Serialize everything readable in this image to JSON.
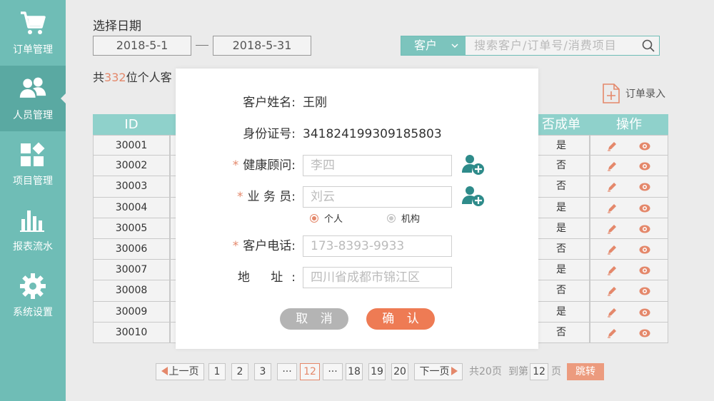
{
  "sidebar": {
    "items": [
      {
        "label": "订单管理",
        "icon": "cart-icon"
      },
      {
        "label": "人员管理",
        "icon": "people-icon"
      },
      {
        "label": "项目管理",
        "icon": "grid-icon"
      },
      {
        "label": "报表流水",
        "icon": "bar-chart-icon"
      },
      {
        "label": "系统设置",
        "icon": "gear-icon"
      }
    ],
    "active_index": 1
  },
  "filter": {
    "title": "选择日期",
    "date_from": "2018-5-1",
    "date_to": "2018-5-31"
  },
  "search": {
    "select_value": "客户",
    "placeholder": "搜索客户/订单号/消费项目"
  },
  "summary": {
    "prefix": "共",
    "count": "332",
    "suffix": "位个人客"
  },
  "order_entry_label": "订单录入",
  "table": {
    "headers": {
      "id": "ID",
      "closed": "否成单",
      "actions": "操作"
    },
    "rows": [
      {
        "id": "30001",
        "closed": "是"
      },
      {
        "id": "30002",
        "closed": "否"
      },
      {
        "id": "30003",
        "closed": "否"
      },
      {
        "id": "30004",
        "closed": "是"
      },
      {
        "id": "30005",
        "closed": "是"
      },
      {
        "id": "30006",
        "closed": "否"
      },
      {
        "id": "30007",
        "closed": "是"
      },
      {
        "id": "30008",
        "closed": "否"
      },
      {
        "id": "30009",
        "closed": "是"
      },
      {
        "id": "30010",
        "closed": "否"
      }
    ]
  },
  "pagination": {
    "prev": "上一页",
    "pages": [
      "1",
      "2",
      "3",
      "···",
      "12",
      "···",
      "18",
      "19",
      "20"
    ],
    "current": "12",
    "next": "下一页",
    "total_text": "共20页",
    "goto_prefix": "到第",
    "goto_value": "12",
    "goto_suffix": "页",
    "jump": "跳转"
  },
  "modal": {
    "name_label": "客户姓名:",
    "name_value": "王刚",
    "idcard_label": "身份证号:",
    "idcard_value": "341824199309185803",
    "consultant_label": "健康顾问:",
    "consultant_placeholder": "李四",
    "salesperson_label": "业 务 员:",
    "salesperson_placeholder": "刘云",
    "radio_personal": "个人",
    "radio_org": "机构",
    "phone_label": "客户电话:",
    "phone_placeholder": "173-8393-9933",
    "address_label": "地 址:",
    "address_placeholder": "四川省成都市锦江区",
    "required_mark": "*",
    "cancel": "取 消",
    "confirm": "确 认"
  },
  "colors": {
    "sidebar": "#6fbdb6",
    "table_header": "#8fd1cb",
    "accent_orange": "#e4886b",
    "confirm_button": "#ee7b54"
  }
}
